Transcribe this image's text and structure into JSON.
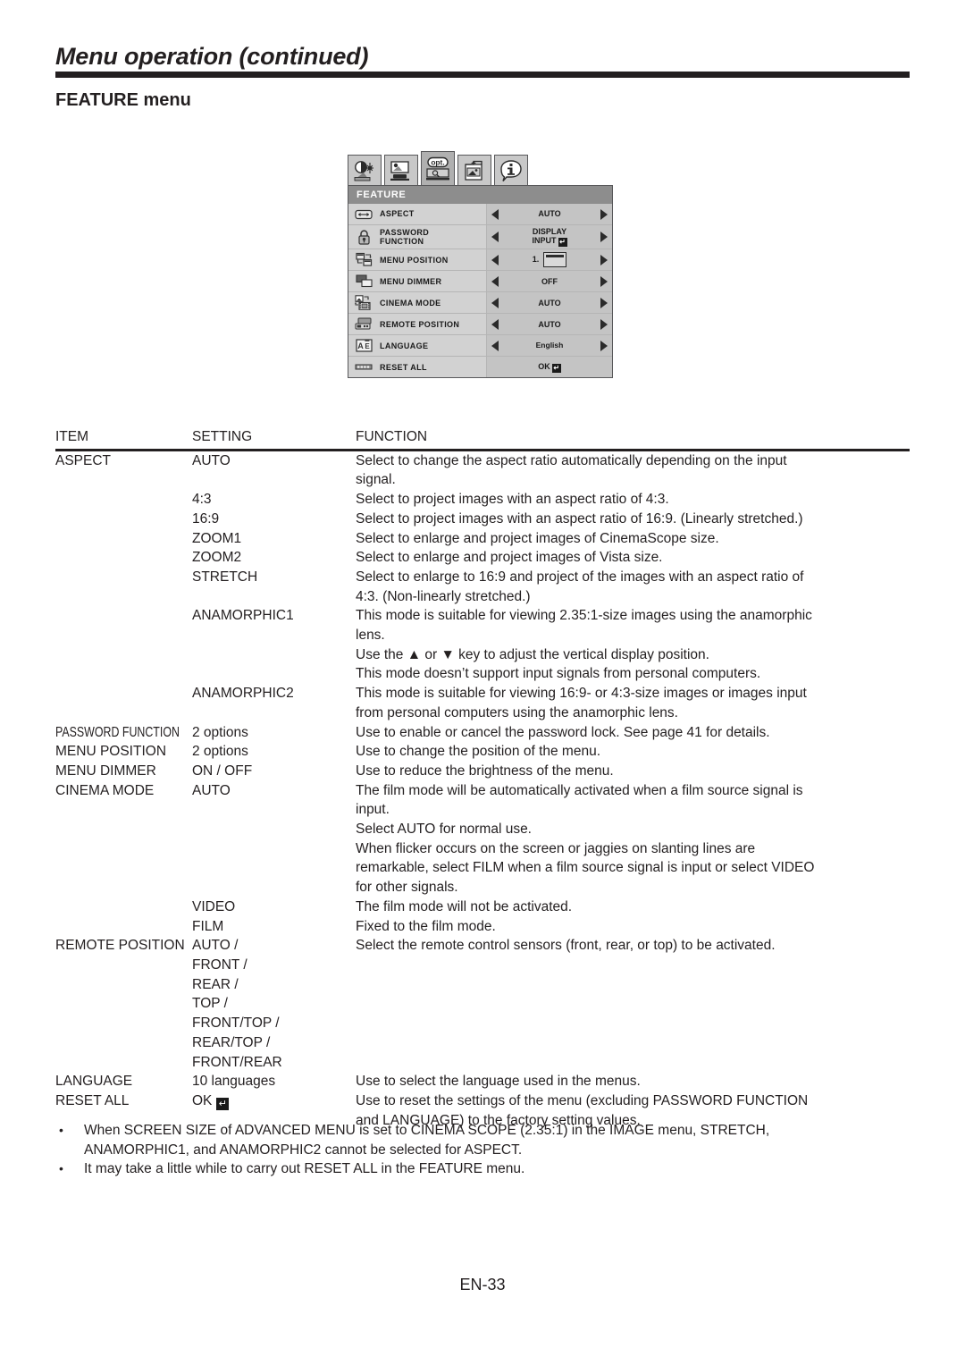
{
  "header": {
    "title": "Menu operation (continued)",
    "section": "FEATURE menu"
  },
  "osd": {
    "title": "FEATURE",
    "tabs": [
      {
        "name": "image-tab",
        "label": "image"
      },
      {
        "name": "installation-tab",
        "label": "installation"
      },
      {
        "name": "option-tab",
        "label": "opt.",
        "selected": true
      },
      {
        "name": "option2-tab",
        "label": "option2"
      },
      {
        "name": "information-tab",
        "label": "i"
      }
    ],
    "rows": [
      {
        "icon": "aspect-icon",
        "label": "ASPECT",
        "value": "AUTO",
        "arrows": true,
        "type": "text"
      },
      {
        "icon": "lock-icon",
        "label": "PASSWORD\nFUNCTION",
        "value": "DISPLAY\nINPUT",
        "arrows": true,
        "type": "enter"
      },
      {
        "icon": "menu-position-icon",
        "label": "MENU POSITION",
        "value": "1.",
        "arrows": true,
        "type": "menupos"
      },
      {
        "icon": "menu-dimmer-icon",
        "label": "MENU DIMMER",
        "value": "OFF",
        "arrows": true,
        "type": "text"
      },
      {
        "icon": "cinema-mode-icon",
        "label": "CINEMA MODE",
        "value": "AUTO",
        "arrows": true,
        "type": "text"
      },
      {
        "icon": "remote-position-icon",
        "label": "REMOTE POSITION",
        "value": "AUTO",
        "arrows": true,
        "type": "text"
      },
      {
        "icon": "language-icon",
        "label": "LANGUAGE",
        "value": "English",
        "arrows": true,
        "type": "text-thin"
      },
      {
        "icon": "reset-all-icon",
        "label": "RESET ALL",
        "value": "OK",
        "arrows": false,
        "type": "enter"
      }
    ]
  },
  "table": {
    "headers": {
      "item": "ITEM",
      "setting": "SETTING",
      "function": "FUNCTION"
    },
    "rows": [
      {
        "item": "ASPECT",
        "setting": "AUTO",
        "function": "Select to change the aspect ratio automatically depending on the input\nsignal."
      },
      {
        "item": "",
        "setting": "4:3",
        "function": "Select to project images with an aspect ratio of 4:3."
      },
      {
        "item": "",
        "setting": "16:9",
        "function": "Select to project images with an aspect ratio of 16:9. (Linearly stretched.)"
      },
      {
        "item": "",
        "setting": "ZOOM1",
        "function": "Select to enlarge and project images of CinemaScope size."
      },
      {
        "item": "",
        "setting": "ZOOM2",
        "function": "Select to enlarge and project images of Vista size."
      },
      {
        "item": "",
        "setting": "STRETCH",
        "function": "Select to enlarge to 16:9 and project of the images with an aspect ratio of\n4:3. (Non-linearly stretched.)"
      },
      {
        "item": "",
        "setting": "ANAMORPHIC1",
        "function": "This mode is suitable for viewing 2.35:1-size images using the anamorphic\nlens.\nUse the ▲ or ▼ key to adjust the vertical display position.\nThis mode doesn’t support input signals from personal computers."
      },
      {
        "item": "",
        "setting": "ANAMORPHIC2",
        "function": "This mode is suitable for viewing 16:9- or 4:3-size images or images input\nfrom personal computers using the anamorphic lens."
      },
      {
        "item": "PASSWORD FUNCTION",
        "item_condensed": true,
        "setting": "2 options",
        "function": "Use to enable or cancel the password lock. See page 41 for details."
      },
      {
        "item": "MENU POSITION",
        "setting": "2 options",
        "function": "Use to change the position of the menu."
      },
      {
        "item": "MENU DIMMER",
        "setting": "ON / OFF",
        "function": "Use to reduce the brightness of the menu."
      },
      {
        "item": "CINEMA MODE",
        "setting": "AUTO",
        "function": "The film mode will be automatically activated when a film source signal is\ninput.\nSelect AUTO for normal use.\nWhen flicker occurs on the screen or jaggies on slanting lines are\nremarkable, select FILM when a film source signal is input or select VIDEO\nfor other signals."
      },
      {
        "item": "",
        "setting": "VIDEO",
        "function": "The film mode will not be activated."
      },
      {
        "item": "",
        "setting": "FILM",
        "function": "Fixed to the film mode."
      },
      {
        "item": "REMOTE POSITION",
        "setting": "AUTO /\nFRONT /\nREAR /\nTOP /\nFRONT/TOP /\nREAR/TOP /\nFRONT/REAR",
        "function": "Select the remote control sensors (front, rear, or top) to be activated."
      },
      {
        "item": "LANGUAGE",
        "setting": "10 languages",
        "function": "Use to select the language used in the menus."
      },
      {
        "item": "RESET ALL",
        "setting": "OK",
        "setting_enter": true,
        "function": "Use to reset the settings of the menu (excluding PASSWORD FUNCTION\nand LANGUAGE) to the factory setting values."
      }
    ]
  },
  "notes": [
    {
      "bullet": "•",
      "text": "When SCREEN SIZE of ADVANCED MENU is set to CINEMA SCOPE (2.35:1) in the IMAGE menu, STRETCH,\nANAMORPHIC1, and ANAMORPHIC2 cannot be selected for ASPECT."
    },
    {
      "bullet": "•",
      "text": "It may take a little while to carry out RESET ALL in the FEATURE menu."
    }
  ],
  "footer": {
    "page": "EN-33"
  }
}
